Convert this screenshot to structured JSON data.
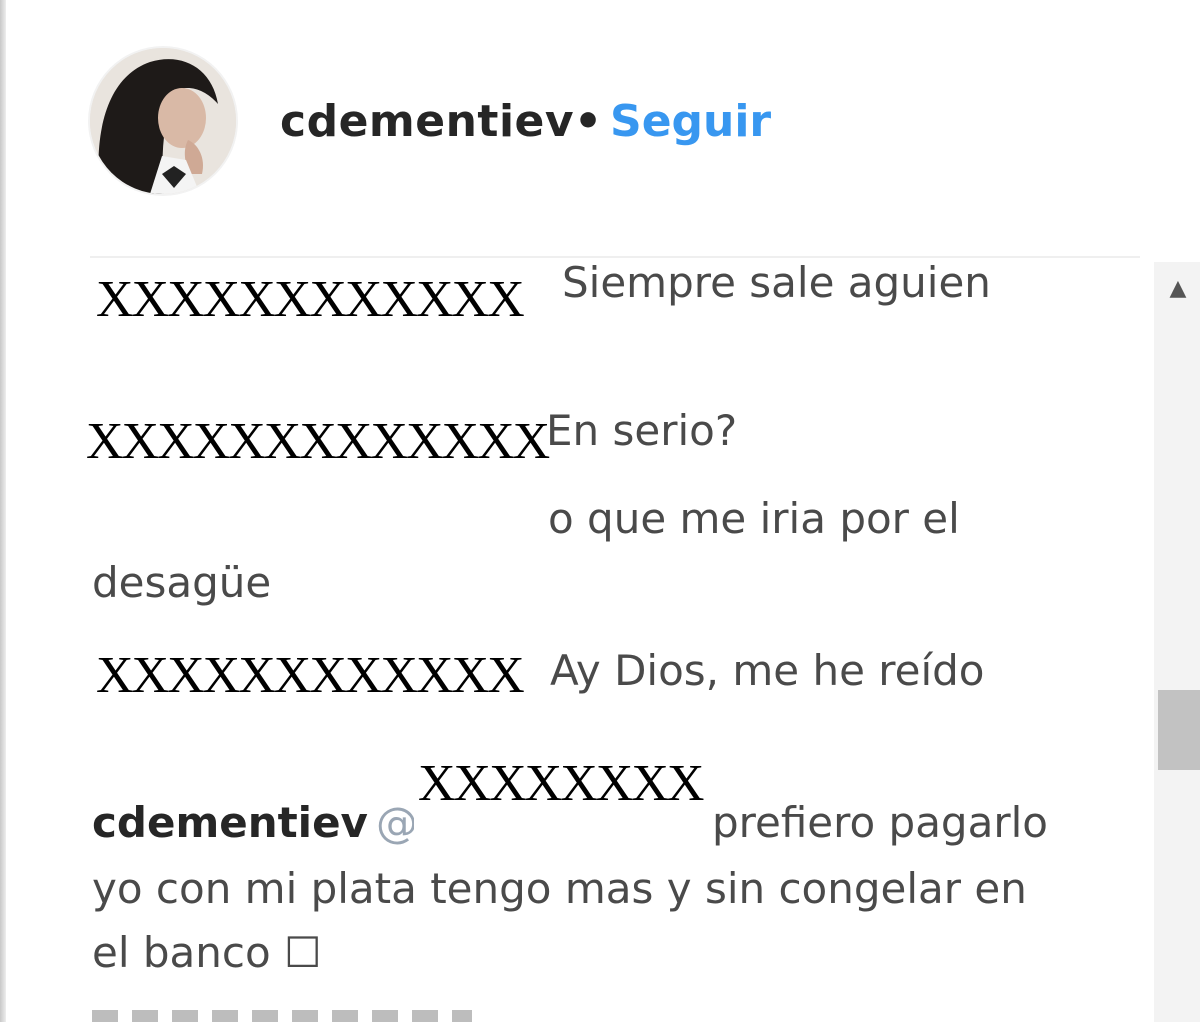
{
  "header": {
    "username": "cdementiev",
    "separator": "•",
    "follow_label": "Seguir"
  },
  "comments": [
    {
      "redacted_user": "XXXXXXXXXXXX",
      "text": "Siempre sale aguien"
    },
    {
      "redacted_user": "XXXXXXXXXXXXX",
      "text": "En serio?"
    },
    {
      "text_line1": "o que me iria por el",
      "text_line2": "desagüe"
    },
    {
      "redacted_user": "XXXXXXXXXXXX",
      "text": "Ay Dios, me he reído"
    },
    {
      "user": "cdementiev",
      "mention": "@",
      "redacted_mention": "XXXXXXXX",
      "text_line1": "prefiero pagarlo",
      "text_line2": "yo con mi plata tengo mas y sin congelar en",
      "text_line3": "el banco ☐"
    }
  ],
  "icons": {
    "scroll_up": "▲"
  }
}
